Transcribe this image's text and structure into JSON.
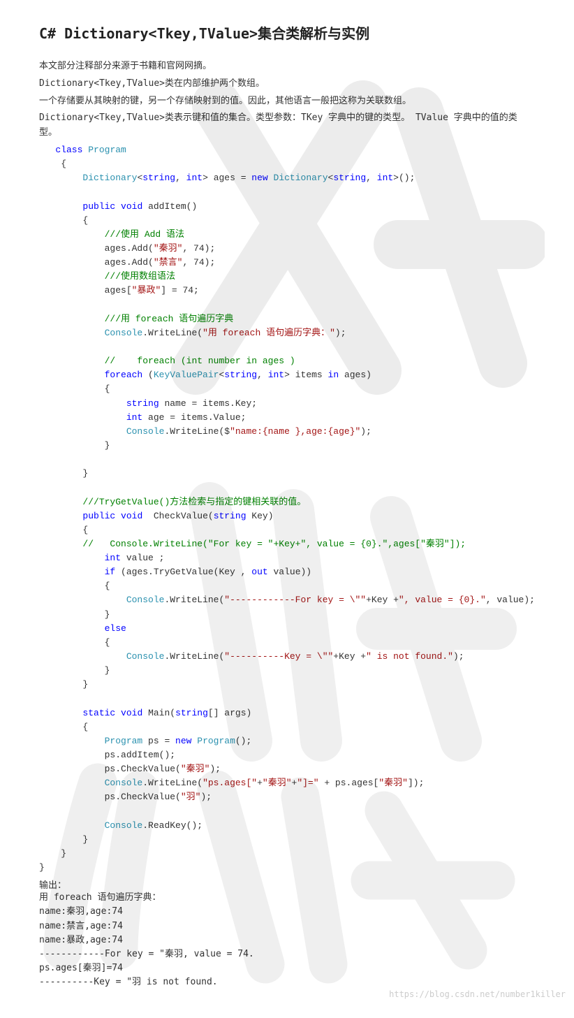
{
  "title": "C# Dictionary<Tkey,TValue>集合类解析与实例",
  "intro": [
    "本文部分注释部分来源于书籍和官网网摘。",
    "Dictionary<Tkey,TValue>类在内部维护两个数组。",
    "一个存储要从其映射的键，另一个存储映射到的值。因此，其他语言一般把这称为关联数组。",
    " Dictionary<Tkey,TValue>类表示键和值的集合。类型参数：TKey 字典中的键的类型。 TValue 字典中的值的类型。"
  ],
  "code": {
    "l01": "class",
    "l01b": "Program",
    "l02": "Dictionary",
    "l02a": "string",
    "l02b": "int",
    "l02c": "new",
    "l02d": "Dictionary",
    "l02e": "string",
    "l02f": "int",
    "l02g": "ages = ",
    "l03": "public",
    "l03a": "void",
    "l03b": " addItem()",
    "l04": "///使用 Add 语法",
    "l05": "ages.Add(",
    "l05a": "\"秦羽\"",
    "l05b": ", 74);",
    "l06": "ages.Add(",
    "l06a": "\"禁言\"",
    "l06b": ", 74);",
    "l07": "///使用数组语法",
    "l08": "ages[",
    "l08a": "\"暴政\"",
    "l08b": "] = 74;",
    "l09": "///用 foreach 语句遍历字典",
    "l10": "Console",
    "l10a": ".WriteLine(",
    "l10b": "\"用 foreach 语句遍历字典：\"",
    "l10c": ");",
    "l11": "//    foreach (int number in ages )",
    "l12": "foreach",
    "l12a": " (",
    "l12b": "KeyValuePair",
    "l12c": "string",
    "l12d": "int",
    "l12e": "> items ",
    "l12f": "in",
    "l12g": " ages)",
    "l13": "string",
    "l13a": " name = items.Key;",
    "l14": "int",
    "l14a": " age = items.Value;",
    "l15": "Console",
    "l15a": ".WriteLine($",
    "l15b": "\"name:{name },age:{age}\"",
    "l15c": ");",
    "l16": "///TryGetValue()方法检索与指定的键相关联的值。",
    "l17": "public",
    "l17a": "void",
    "l17b": "  CheckValue(",
    "l17c": "string",
    "l17d": " Key)",
    "l18": "//   Console.WriteLine(\"For key = \"+Key+\", value = {0}.\",ages[\"秦羽\"]);",
    "l19": "int",
    "l19a": " value ;",
    "l20": "if",
    "l20a": " (ages.TryGetValue(Key , ",
    "l20b": "out",
    "l20c": " value))",
    "l21": "Console",
    "l21a": ".WriteLine(",
    "l21b": "\"------------For key = \\\"\"",
    "l21c": "+Key +",
    "l21d": "\", value = {0}.\"",
    "l21e": ", value);",
    "l22": "else",
    "l23": "Console",
    "l23a": ".WriteLine(",
    "l23b": "\"----------Key = \\\"\"",
    "l23c": "+Key +",
    "l23d": "\" is not found.\"",
    "l23e": ");",
    "l24": "static",
    "l24a": "void",
    "l24b": " Main(",
    "l24c": "string",
    "l24d": "[] args)",
    "l25": "Program",
    "l25a": " ps = ",
    "l25b": "new",
    "l25c": "Program",
    "l25d": "();",
    "l26": "ps.addItem();",
    "l27": "ps.CheckValue(",
    "l27a": "\"秦羽\"",
    "l27b": ");",
    "l28": "Console",
    "l28a": ".WriteLine(",
    "l28b": "\"ps.ages[\"",
    "l28c": "+",
    "l28d": "\"秦羽\"",
    "l28e": "+",
    "l28f": "\"]=\"",
    "l28g": " + ps.ages[",
    "l28h": "\"秦羽\"",
    "l28i": "]);",
    "l29": "ps.CheckValue(",
    "l29a": "\"羽\"",
    "l29b": ");",
    "l30": "Console",
    "l30a": ".ReadKey();"
  },
  "outputLabel": "输出：",
  "output": "用 foreach 语句遍历字典：\nname:秦羽,age:74\nname:禁言,age:74\nname:暴政,age:74\n------------For key = \"秦羽, value = 74.\nps.ages[秦羽]=74\n----------Key = \"羽 is not found.",
  "watermarkUrl": "https://blog.csdn.net/number1killer"
}
